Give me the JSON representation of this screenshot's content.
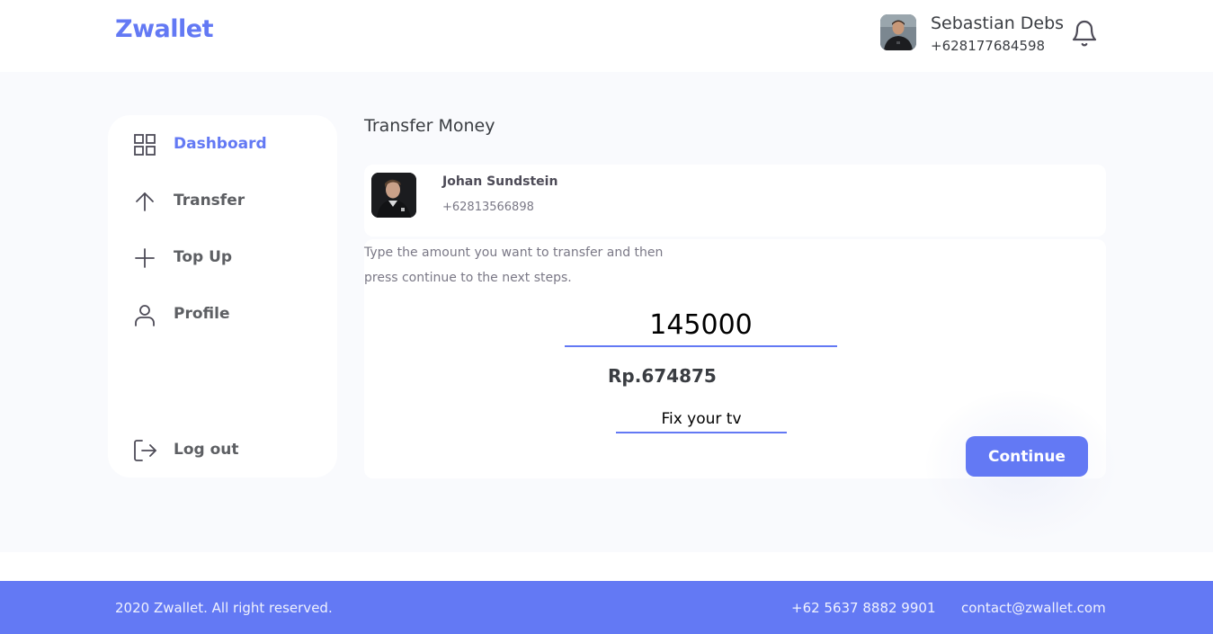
{
  "header": {
    "brand": "Zwallet",
    "user": {
      "name": "Sebastian Debs",
      "phone": "+628177684598"
    },
    "icons": {
      "notification": "bell-icon"
    }
  },
  "sidebar": {
    "items": [
      {
        "label": "Dashboard",
        "icon": "grid-icon",
        "active": true
      },
      {
        "label": "Transfer",
        "icon": "arrow-up-icon",
        "active": false
      },
      {
        "label": "Top Up",
        "icon": "plus-icon",
        "active": false
      },
      {
        "label": "Profile",
        "icon": "user-icon",
        "active": false
      }
    ],
    "logout": {
      "label": "Log out",
      "icon": "logout-icon"
    }
  },
  "main": {
    "title": "Transfer Money",
    "receiver": {
      "name": "Johan Sundstein",
      "phone": "+62813566898"
    },
    "instruction": "Type the amount you want to transfer and then press continue to the next steps.",
    "amount": {
      "value": "145000"
    },
    "balance": "Rp.674875",
    "notes": {
      "value": "Fix your tv"
    },
    "continue_label": "Continue"
  },
  "footer": {
    "copyright": "2020 Zwallet. All right reserved.",
    "phone": "+62 5637 8882 9901",
    "email": "contact@zwallet.com"
  },
  "colors": {
    "accent": "#6379f4",
    "background": "#f9fafd",
    "text": "#3a3d42"
  }
}
